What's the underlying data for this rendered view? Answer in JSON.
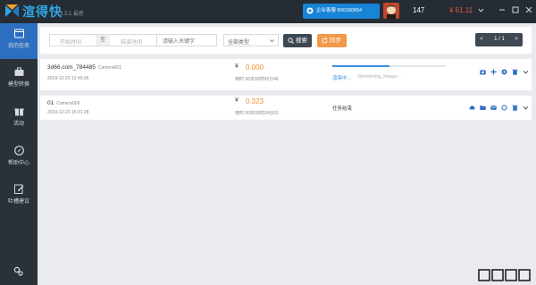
{
  "app": {
    "name": "渲得快",
    "version": "3.3.1",
    "version_tag": "最新",
    "enterprise_btn": "企业客服 800180554",
    "user_id": "147",
    "balance": "¥ 61.11"
  },
  "sidebar": {
    "items": [
      {
        "label": "我的任务",
        "icon": "task-list-icon",
        "active": true
      },
      {
        "label": "模型转换",
        "icon": "briefcase-icon",
        "active": false
      },
      {
        "label": "活动",
        "icon": "gift-icon",
        "active": false
      },
      {
        "label": "帮助中心",
        "icon": "compass-icon",
        "active": false
      },
      {
        "label": "吐槽建议",
        "icon": "edit-icon",
        "active": false
      }
    ],
    "settings_icon": "settings-icon"
  },
  "filter": {
    "start_placeholder": "开始时间",
    "separator": "至",
    "end_placeholder": "结束时间",
    "keyword_placeholder": "请输入关键字",
    "type_value": "全部类型",
    "search_label": "搜索",
    "sync_label": "同步",
    "page_prev": "<",
    "page_text": "1 / 1",
    "page_next": ">"
  },
  "tasks": [
    {
      "name": "3d66.com_784485",
      "camera": "Camera001",
      "time": "2019-12-23 12:46:06",
      "currency": "¥",
      "cost": "0.000",
      "duration": "用时 00天00时02分46",
      "progress": 0.5,
      "status": "渲染中...",
      "substatus": "Rendering_image..."
    },
    {
      "name": "01",
      "camera": "Camera006",
      "time": "2019-12-23 15:31:28",
      "currency": "¥",
      "cost": "0.323",
      "duration": "用时 00天00时24分53",
      "status": "任务结束"
    }
  ],
  "colors": {
    "accent": "#2c6fc0",
    "cost": "#f08c2e",
    "titlebar": "#262c33",
    "sidebar": "#2b3139",
    "enterprise": "#1784d6",
    "sync": "#f2994a",
    "balance": "#e05b3c"
  }
}
